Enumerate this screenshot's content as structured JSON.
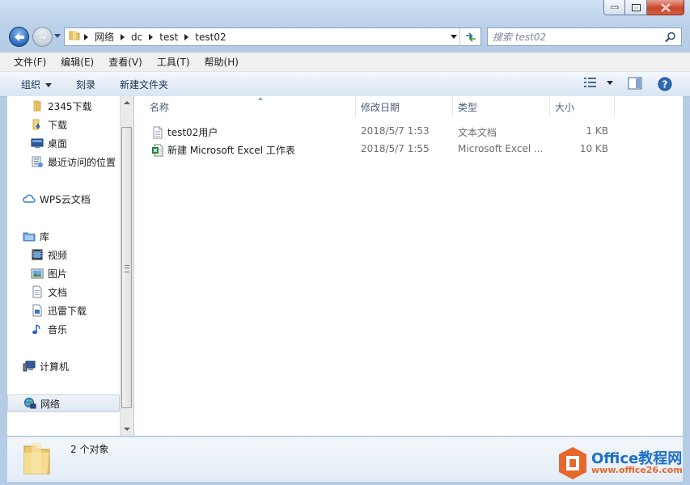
{
  "window": {
    "caption_buttons": [
      "minimize",
      "maximize",
      "close"
    ]
  },
  "address": {
    "crumbs": [
      "网络",
      "dc",
      "test",
      "test02"
    ]
  },
  "search": {
    "placeholder": "搜索 test02"
  },
  "menu": [
    "文件(F)",
    "编辑(E)",
    "查看(V)",
    "工具(T)",
    "帮助(H)"
  ],
  "toolbar": {
    "organize": "组织",
    "burn": "刻录",
    "new_folder": "新建文件夹"
  },
  "nav": {
    "items": [
      {
        "label": "2345下载",
        "icon": "folder-icon",
        "level": "sub"
      },
      {
        "label": "下载",
        "icon": "downloads-icon",
        "level": "sub"
      },
      {
        "label": "桌面",
        "icon": "desktop-icon",
        "level": "sub"
      },
      {
        "label": "最近访问的位置",
        "icon": "recent-places-icon",
        "level": "sub"
      },
      {
        "label": "WPS云文档",
        "icon": "cloud-icon",
        "level": "top"
      },
      {
        "label": "库",
        "icon": "library-icon",
        "level": "top"
      },
      {
        "label": "视频",
        "icon": "video-icon",
        "level": "sub"
      },
      {
        "label": "图片",
        "icon": "pictures-icon",
        "level": "sub"
      },
      {
        "label": "文档",
        "icon": "documents-icon",
        "level": "sub"
      },
      {
        "label": "迅雷下载",
        "icon": "thunder-download-icon",
        "level": "sub"
      },
      {
        "label": "音乐",
        "icon": "music-icon",
        "level": "sub"
      },
      {
        "label": "计算机",
        "icon": "computer-icon",
        "level": "top"
      },
      {
        "label": "网络",
        "icon": "network-icon",
        "level": "top",
        "selected": true
      }
    ]
  },
  "columns": {
    "name": "名称",
    "date": "修改日期",
    "type": "类型",
    "size": "大小"
  },
  "files": [
    {
      "name": "test02用户",
      "date": "2018/5/7 1:53",
      "type": "文本文档",
      "size": "1 KB",
      "icon": "text-file-icon"
    },
    {
      "name": "新建 Microsoft Excel 工作表",
      "date": "2018/5/7 1:55",
      "type": "Microsoft Excel ...",
      "size": "10 KB",
      "icon": "excel-file-icon"
    }
  ],
  "status": {
    "text": "2 个对象"
  },
  "watermark": {
    "title": "Office教程网",
    "url": "www.office26.com"
  },
  "colors": {
    "accent": "#1f6fc6",
    "close_red": "#c9462c",
    "watermark_orange": "#e7682d"
  }
}
